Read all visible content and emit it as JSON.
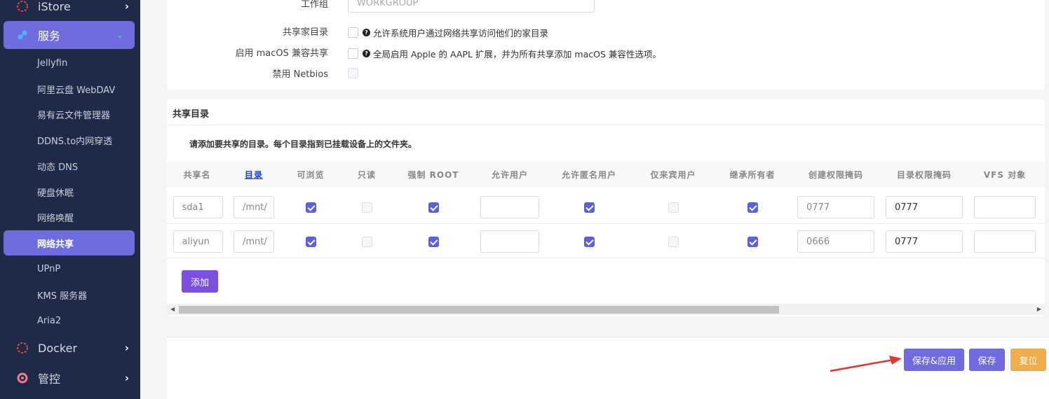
{
  "sidebar": {
    "top_items": [
      {
        "label": "iStore",
        "icon": "istore-icon"
      },
      {
        "label": "服务",
        "icon": "services-icon"
      },
      {
        "label": "Docker",
        "icon": "docker-icon"
      },
      {
        "label": "管控",
        "icon": "control-icon"
      }
    ],
    "sub_items": [
      "Jellyfin",
      "阿里云盘 WebDAV",
      "易有云文件管理器",
      "DDNS.to内网穿透",
      "动态 DNS",
      "硬盘休眠",
      "网络唤醒",
      "网络共享",
      "UPnP",
      "KMS 服务器",
      "Aria2"
    ],
    "active_sub": "网络共享"
  },
  "general": {
    "workgroup_label": "工作组",
    "workgroup_value": "WORKGROUP",
    "homes_label": "共享家目录",
    "homes_help": "允许系统用户通过网络共享访问他们的家目录",
    "macos_label": "启用 macOS 兼容共享",
    "macos_help": "全局启用 Apple 的 AAPL 扩展，并为所有共享添加 macOS 兼容性选项。",
    "netbios_label": "禁用 Netbios"
  },
  "shares": {
    "title": "共享目录",
    "description": "请添加要共享的目录。每个目录指到已挂载设备上的文件夹。",
    "headers": [
      "共享名",
      "目录",
      "可浏览",
      "只读",
      "强制 ROOT",
      "允许用户",
      "允许匿名用户",
      "仅来宾用户",
      "继承所有者",
      "创建权限掩码",
      "目录权限掩码",
      "VFS 对象"
    ],
    "rows": [
      {
        "name": "sda1",
        "path": "/mnt/",
        "browseable": true,
        "read_only": false,
        "force_root": true,
        "users": "",
        "guest_ok": true,
        "guest_only": false,
        "inherit_owner": true,
        "create_mask": "0777",
        "dir_mask": "0777",
        "vfs": ""
      },
      {
        "name": "aliyun",
        "path": "/mnt/",
        "browseable": true,
        "read_only": false,
        "force_root": true,
        "users": "",
        "guest_ok": true,
        "guest_only": false,
        "inherit_owner": true,
        "create_mask": "0666",
        "dir_mask": "0777",
        "vfs": ""
      }
    ],
    "add_label": "添加"
  },
  "actions": {
    "save_apply": "保存&应用",
    "save": "保存",
    "reset": "复位"
  },
  "colors": {
    "sidebar_bg": "#1f2a48",
    "accent": "#6f6cdf",
    "add_button": "#7b4fe0",
    "reset_button": "#f0ad4e",
    "annotation_arrow": "#e8332a"
  }
}
